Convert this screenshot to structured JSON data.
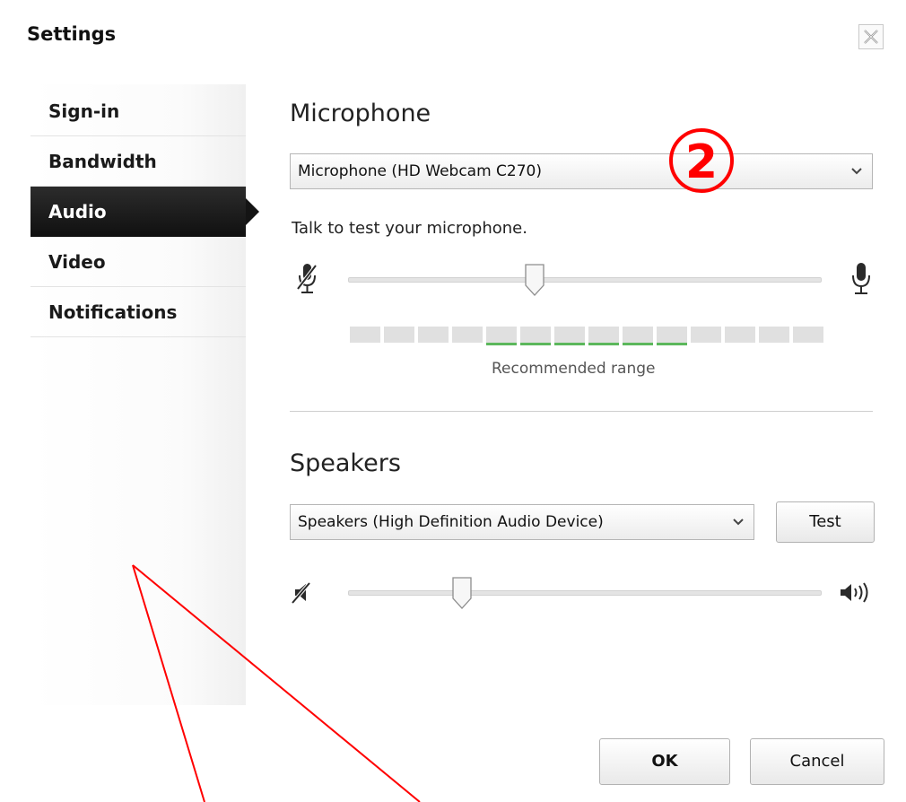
{
  "dialog": {
    "title": "Settings"
  },
  "sidebar": {
    "items": [
      {
        "label": "Sign-in",
        "active": false
      },
      {
        "label": "Bandwidth",
        "active": false
      },
      {
        "label": "Audio",
        "active": true
      },
      {
        "label": "Video",
        "active": false
      },
      {
        "label": "Notifications",
        "active": false
      }
    ]
  },
  "microphone": {
    "heading": "Microphone",
    "device": "Microphone (HD Webcam C270)",
    "hint": "Talk to test your microphone.",
    "level_fraction": 0.39,
    "meter_segments_total": 14,
    "meter_recommended_start": 4,
    "meter_recommended_count": 6,
    "recommended_label": "Recommended range"
  },
  "speakers": {
    "heading": "Speakers",
    "device": "Speakers (High Definition Audio Device)",
    "test_label": "Test",
    "volume_fraction": 0.23
  },
  "footer": {
    "ok_label": "OK",
    "cancel_label": "Cancel"
  },
  "annotation": {
    "step_marker": "②",
    "color": "#ff0000"
  },
  "icons": {
    "close": "close-icon",
    "mic_muted": "microphone-muted-icon",
    "mic": "microphone-icon",
    "speaker_muted": "speaker-muted-icon",
    "speaker": "speaker-volume-icon",
    "dropdown": "chevron-down-icon"
  }
}
